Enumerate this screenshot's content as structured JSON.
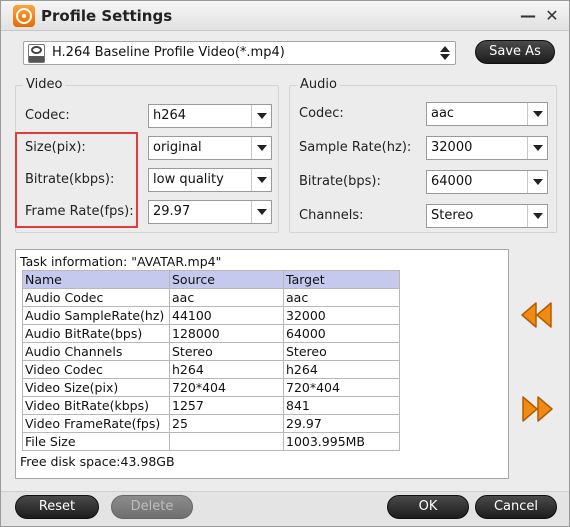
{
  "window": {
    "title": "Profile Settings"
  },
  "icons": {
    "app": "orange-film-reel-icon",
    "minimize": "minimize-icon",
    "close": "close-icon",
    "format": "mp4-file-icon",
    "previous": "double-chevron-left-icon",
    "next": "double-chevron-right-icon"
  },
  "controls": {
    "minimize_glyph": "—",
    "close_glyph": "✕"
  },
  "profile": {
    "value": "H.264 Baseline Profile Video(*.mp4)",
    "save_as_label": "Save As"
  },
  "video": {
    "title": "Video",
    "codec": {
      "label": "Codec:",
      "value": "h264"
    },
    "size": {
      "label": "Size(pix):",
      "value": "original"
    },
    "bitrate": {
      "label": "Bitrate(kbps):",
      "value": "low quality"
    },
    "frame_rate": {
      "label": "Frame Rate(fps):",
      "value": "29.97"
    }
  },
  "audio": {
    "title": "Audio",
    "codec": {
      "label": "Codec:",
      "value": "aac"
    },
    "sample_rate": {
      "label": "Sample Rate(hz):",
      "value": "32000"
    },
    "bitrate": {
      "label": "Bitrate(bps):",
      "value": "64000"
    },
    "channels": {
      "label": "Channels:",
      "value": "Stereo"
    }
  },
  "task": {
    "info_line": "Task information: \"AVATAR.mp4\"",
    "headers": [
      "Name",
      "Source",
      "Target"
    ],
    "rows": [
      [
        "Audio Codec",
        "aac",
        "aac"
      ],
      [
        "Audio SampleRate(hz)",
        "44100",
        "32000"
      ],
      [
        "Audio BitRate(bps)",
        "128000",
        "64000"
      ],
      [
        "Audio Channels",
        "Stereo",
        "Stereo"
      ],
      [
        "Video Codec",
        "h264",
        "h264"
      ],
      [
        "Video Size(pix)",
        "720*404",
        "720*404"
      ],
      [
        "Video BitRate(kbps)",
        "1257",
        "841"
      ],
      [
        "Video FrameRate(fps)",
        "25",
        "29.97"
      ],
      [
        "File Size",
        "",
        "1003.995MB"
      ]
    ],
    "free_disk": "Free disk space:43.98GB"
  },
  "buttons": {
    "reset": "Reset",
    "delete": "Delete",
    "ok": "OK",
    "cancel": "Cancel"
  },
  "colors": {
    "accent_orange": "#f08a12",
    "highlight_red": "#e23b3b",
    "table_header": "#c5c9ee"
  }
}
